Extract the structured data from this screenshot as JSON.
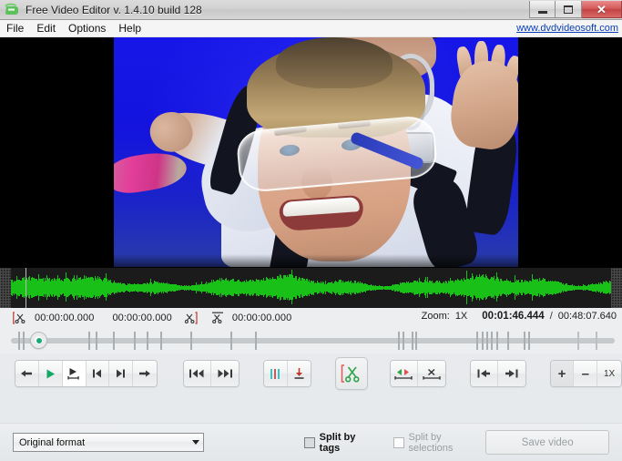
{
  "window": {
    "title": "Free Video Editor v. 1.4.10 build 128",
    "app_icon": "video-editor-icon",
    "minimize_label": "Minimize",
    "maximize_label": "Maximize",
    "close_label": "Close"
  },
  "menu": {
    "items": [
      {
        "label": "File",
        "name": "menu-file"
      },
      {
        "label": "Edit",
        "name": "menu-edit"
      },
      {
        "label": "Options",
        "name": "menu-options"
      },
      {
        "label": "Help",
        "name": "menu-help"
      }
    ],
    "web_link": "www.dvdvideosoft.com"
  },
  "preview": {
    "description": "skydiver tandem jump video frame"
  },
  "timeline": {
    "selection_start": "00:00:00.000",
    "selection_duration": "00:00:00.000",
    "selection_end": "00:00:00.000",
    "zoom_label": "Zoom:",
    "zoom_value": "1X",
    "current_time": "00:01:46.444",
    "time_separator": "/",
    "total_time": "00:48:07.640"
  },
  "transport": {
    "group1": [
      {
        "name": "step-back-button",
        "icon": "arrow-left-icon",
        "label": ""
      },
      {
        "name": "play-button",
        "icon": "play-icon",
        "label": ""
      },
      {
        "name": "play-selection-button",
        "icon": "play-selection-icon",
        "label": ""
      },
      {
        "name": "prev-frame-button",
        "icon": "skip-to-start-icon",
        "label": ""
      },
      {
        "name": "next-frame-button",
        "icon": "skip-to-end-icon",
        "label": ""
      },
      {
        "name": "step-forward-button",
        "icon": "arrow-right-icon",
        "label": ""
      }
    ],
    "group2": [
      {
        "name": "rewind-button",
        "icon": "rewind-icon",
        "label": ""
      },
      {
        "name": "fast-forward-button",
        "icon": "fast-forward-icon",
        "label": ""
      }
    ],
    "group3": [
      {
        "name": "add-tag-button",
        "icon": "tag-markers-icon",
        "label": ""
      },
      {
        "name": "save-tag-button",
        "icon": "download-arrow-icon",
        "label": ""
      }
    ],
    "cut_button": {
      "name": "cut-button",
      "icon": "scissors-icon",
      "label": ""
    },
    "group4": [
      {
        "name": "invert-selection-button",
        "icon": "invert-selection-icon",
        "label": ""
      },
      {
        "name": "delete-selection-button",
        "icon": "delete-selection-icon",
        "label": ""
      }
    ],
    "group5": [
      {
        "name": "jump-to-start-button",
        "icon": "jump-start-icon",
        "label": ""
      },
      {
        "name": "jump-to-end-button",
        "icon": "jump-end-icon",
        "label": ""
      }
    ],
    "group6": [
      {
        "name": "zoom-in-button",
        "icon": "plus-icon",
        "label": "+"
      },
      {
        "name": "zoom-out-button",
        "icon": "minus-icon",
        "label": "–"
      },
      {
        "name": "zoom-reset-button",
        "icon": "zoom-level-icon",
        "label": "1X"
      }
    ]
  },
  "footer": {
    "format_value": "Original format",
    "split_by_tags_label": "Split by tags",
    "split_by_tags_checked": true,
    "split_by_selections_label": "Split by selections",
    "split_by_selections_checked": false,
    "save_video_label": "Save video"
  },
  "colors": {
    "accent_green": "#12a765",
    "waveform_green": "#18c018",
    "link_blue": "#0b3fb5",
    "close_red": "#c44242",
    "video_blue": "#1616e8"
  }
}
